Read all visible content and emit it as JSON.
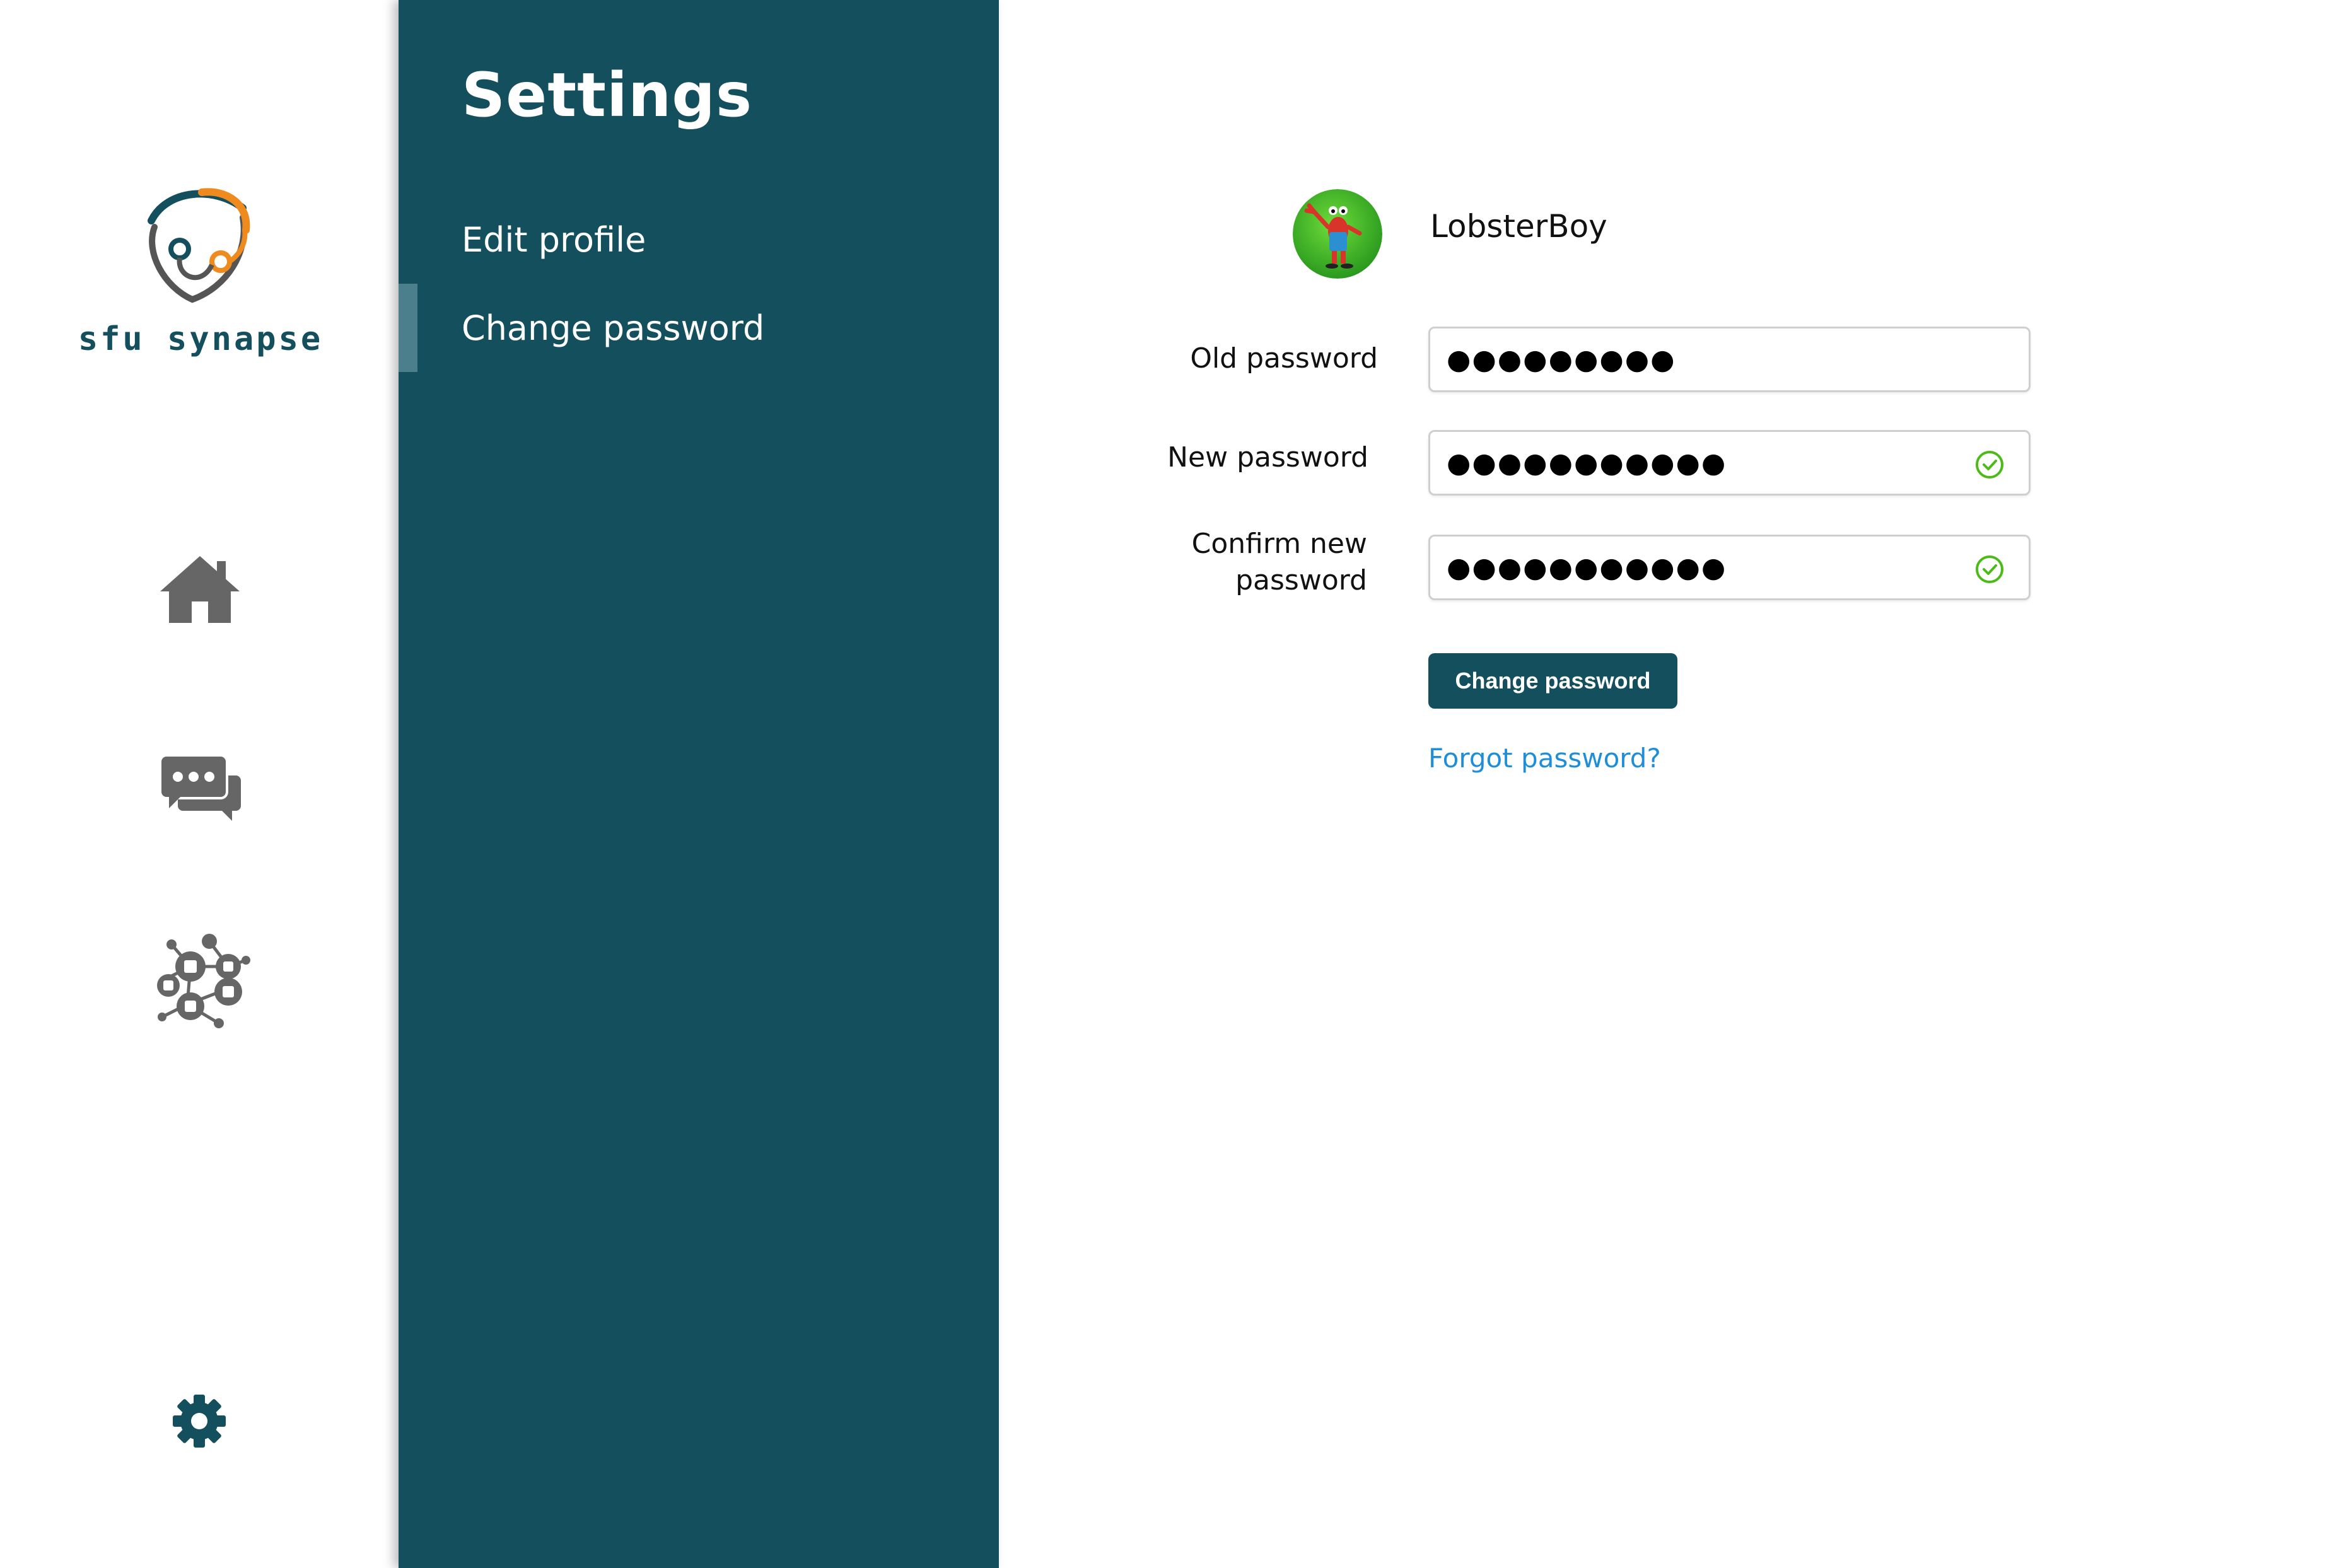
{
  "brand": {
    "name": "sfu synapse",
    "colors": {
      "teal": "#134f5c",
      "orange": "#ef8a1f",
      "gray": "#666666"
    }
  },
  "rail": {
    "items": [
      {
        "icon": "home-icon"
      },
      {
        "icon": "chat-icon"
      },
      {
        "icon": "network-icon"
      },
      {
        "icon": "gear-icon",
        "active": true
      }
    ]
  },
  "settings": {
    "title": "Settings",
    "items": [
      {
        "label": "Edit profile"
      },
      {
        "label": "Change password",
        "active": true
      }
    ],
    "bg_color": "#134f5c"
  },
  "profile": {
    "username": "LobsterBoy",
    "avatar_icon": "lobster-avatar"
  },
  "form": {
    "old_password": {
      "label": "Old password",
      "value": "●●●●●●●●●"
    },
    "new_password": {
      "label": "New password",
      "value": "●●●●●●●●●●●",
      "valid": true
    },
    "confirm_password": {
      "label_line1": "Confirm new",
      "label_line2": "password",
      "value": "●●●●●●●●●●●",
      "valid": true
    },
    "submit_label": "Change password",
    "forgot_label": "Forgot password?",
    "valid_color": "#4cbb17",
    "link_color": "#1f8ed8"
  }
}
